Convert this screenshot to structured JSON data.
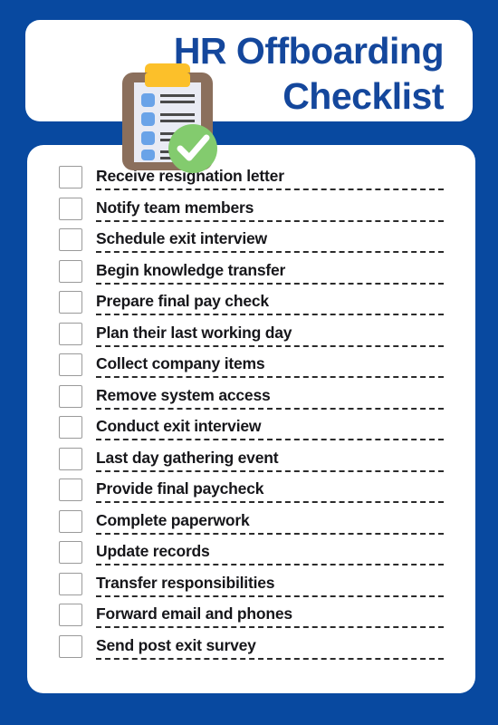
{
  "page": {
    "background_color": "#0849a0",
    "card_color": "#ffffff"
  },
  "header": {
    "title_line_1": "HR Offboarding",
    "title_line_2": "Checklist",
    "title_color": "#14479c",
    "icon": "clipboard-check-icon"
  },
  "illustration": {
    "board_color": "#8b6f5c",
    "clip_color": "#fcc02a",
    "paper_color": "#e9ebf4",
    "bullet_color": "#6aa3e8",
    "line_color": "#4a4a4a",
    "check_circle_color": "#83cb6e",
    "check_mark_color": "#ffffff"
  },
  "checklist": {
    "checkbox_border_color": "#9a9a9a",
    "rule_color": "#2b2b2b",
    "items": [
      {
        "label": "Receive resignation letter",
        "checked": false
      },
      {
        "label": "Notify team members",
        "checked": false
      },
      {
        "label": "Schedule exit interview",
        "checked": false
      },
      {
        "label": "Begin knowledge transfer",
        "checked": false
      },
      {
        "label": "Prepare final pay check",
        "checked": false
      },
      {
        "label": "Plan their last working day",
        "checked": false
      },
      {
        "label": "Collect company items",
        "checked": false
      },
      {
        "label": "Remove system access",
        "checked": false
      },
      {
        "label": "Conduct exit interview",
        "checked": false
      },
      {
        "label": "Last day gathering event",
        "checked": false
      },
      {
        "label": "Provide final paycheck",
        "checked": false
      },
      {
        "label": "Complete paperwork",
        "checked": false
      },
      {
        "label": "Update records",
        "checked": false
      },
      {
        "label": "Transfer responsibilities",
        "checked": false
      },
      {
        "label": "Forward email and phones",
        "checked": false
      },
      {
        "label": "Send post exit survey",
        "checked": false
      }
    ]
  }
}
